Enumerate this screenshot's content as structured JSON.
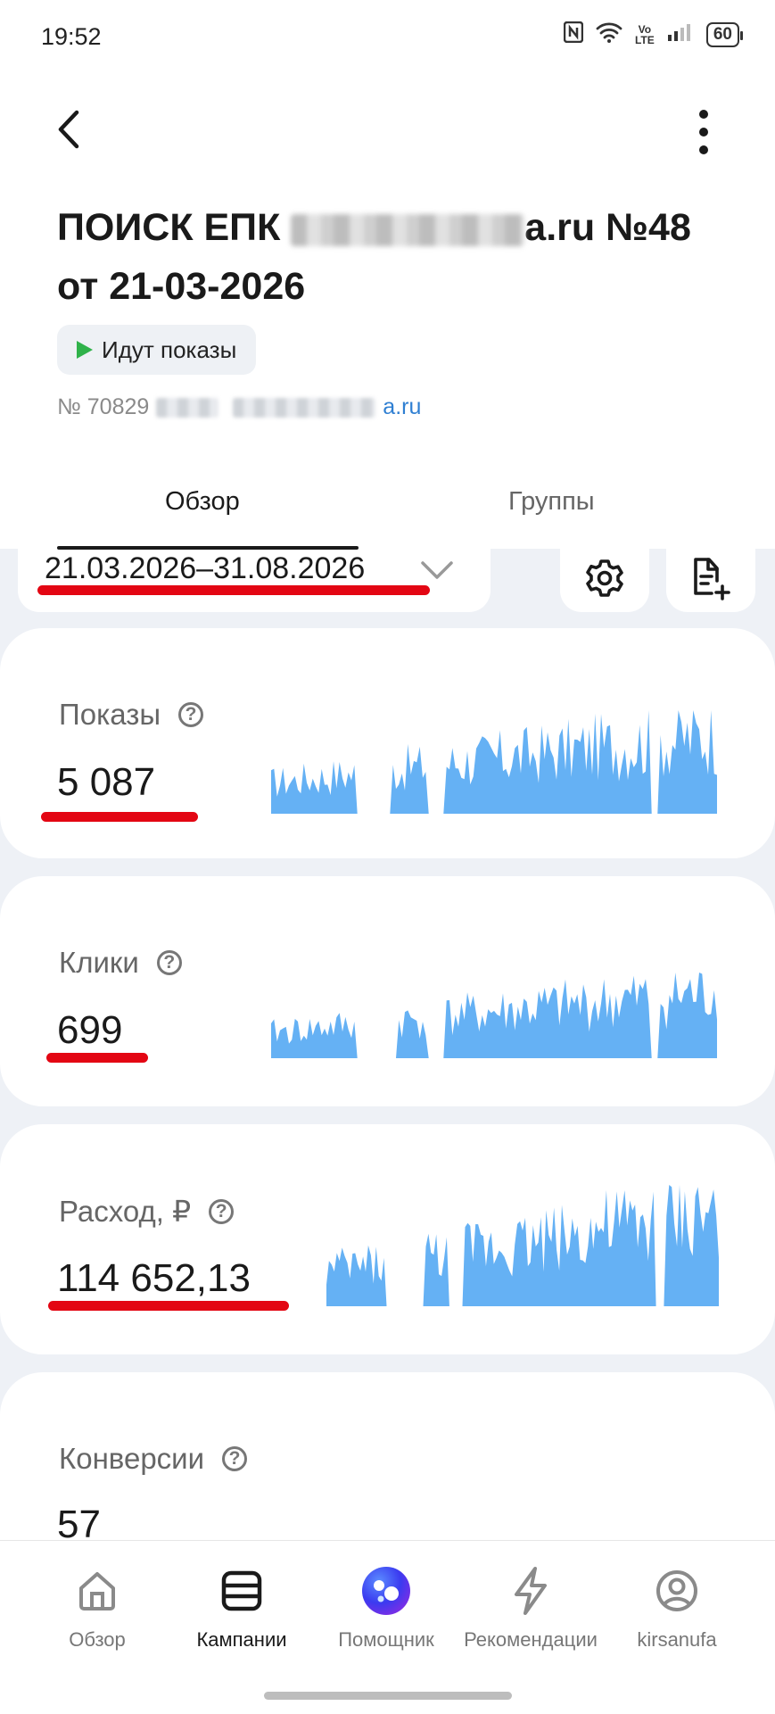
{
  "status_bar": {
    "time": "19:52",
    "network": "Vo LTE",
    "battery": "60"
  },
  "header": {
    "title_part1": "ПОИСК ЕПК ",
    "title_part2": "a.ru №48",
    "title_line2": "от 21-03-2026",
    "status_chip": "Идут показы",
    "id_prefix": "№ 70829",
    "id_suffix": "a.ru"
  },
  "tabs": [
    {
      "label": "Обзор",
      "active": true
    },
    {
      "label": "Группы",
      "active": false
    }
  ],
  "date_range": {
    "label": "21.03.2026–31.08.2026"
  },
  "metrics": [
    {
      "label": "Показы",
      "value": "5 087"
    },
    {
      "label": "Клики",
      "value": "699"
    },
    {
      "label": "Расход, ₽",
      "value": "114 652,13"
    },
    {
      "label": "Конверсии",
      "value": "57"
    }
  ],
  "nav": [
    {
      "label": "Обзор",
      "icon": "home-icon",
      "active": false
    },
    {
      "label": "Кампании",
      "icon": "campaigns-icon",
      "active": true
    },
    {
      "label": "Помощник",
      "icon": "assistant-icon",
      "active": false
    },
    {
      "label": "Рекомендации",
      "icon": "lightning-icon",
      "active": false
    },
    {
      "label": "kirsanufa",
      "icon": "profile-icon",
      "active": false
    }
  ],
  "colors": {
    "accent_red": "#e30613",
    "spark_blue": "#65b1f4",
    "status_green": "#2fb24a",
    "link_blue": "#2f7fd2"
  }
}
